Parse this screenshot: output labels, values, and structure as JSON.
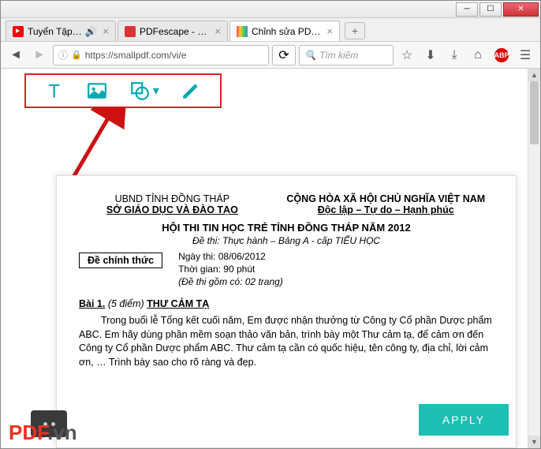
{
  "tabs": [
    {
      "label": "Tuyển Tập Nhạc",
      "icon": "youtube"
    },
    {
      "label": "PDFescape - Free P",
      "icon": "pdfescape"
    },
    {
      "label": "Chỉnh sửa PDF - Ph",
      "icon": "smallpdf",
      "active": true
    }
  ],
  "url": "https://smallpdf.com/vi/e",
  "search_placeholder": "Tìm kiếm",
  "apply_label": "APPLY",
  "doc": {
    "left1": "UBND TỈNH ĐỒNG THÁP",
    "left2": "SỞ GIÁO DỤC VÀ ĐÀO TẠO",
    "right1": "CỘNG HÒA XÃ HỘI CHỦ NGHĨA VIỆT NAM",
    "right2": "Độc lập – Tự do – Hạnh phúc",
    "title": "HỘI THI TIN HỌC TRẺ TỈNH ĐỒNG THÁP  NĂM 2012",
    "sub": "Đề thi: Thực hành – Bảng A - cấp  TIỂU HỌC",
    "ngay": "Ngày thi:  08/06/2012",
    "thoigian": "Thời gian:  90 phút",
    "gom": "(Đề thi gồm có: 02 trang)",
    "chinhthuc": "Đề chính thức",
    "bai_label": "Bài 1.",
    "bai_diem": "(5 điểm)",
    "bai_title": "THƯ CẢM TẠ",
    "body": "Trong buổi lễ Tổng kết cuối năm, Em được nhận thưởng từ Công ty Cổ phần Dược phẩm ABC. Em hãy dùng phần mềm soạn thảo văn bản, trình bày một Thư cảm tạ, để cảm ơn đến Công ty Cổ phần Dược phẩm ABC. Thư cảm tạ cần có quốc hiệu, tên công ty, địa chỉ, lời cảm ơn, … Trình bày sao cho rõ ràng và đẹp."
  },
  "watermark": {
    "p": "PDF",
    "v": ".vn"
  }
}
